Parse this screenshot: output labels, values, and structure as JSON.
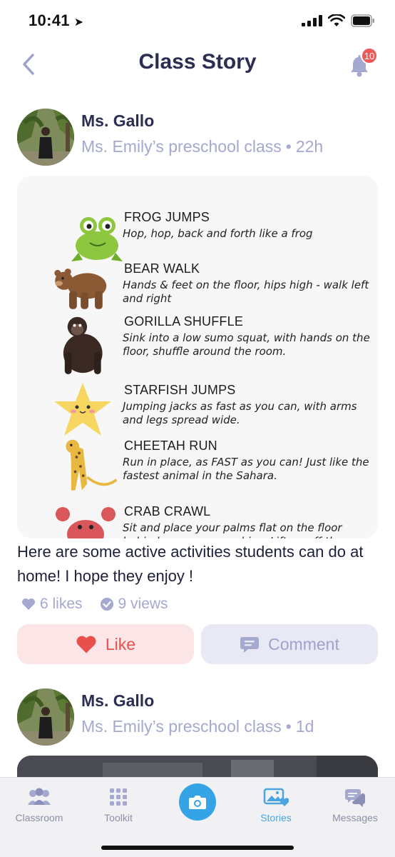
{
  "status_bar": {
    "time": "10:41",
    "location_icon": "location-arrow-icon"
  },
  "header": {
    "title": "Class Story",
    "notification_count": "10"
  },
  "posts": [
    {
      "author": "Ms. Gallo",
      "class_name": "Ms. Emily’s preschool class",
      "separator": "•",
      "time_ago": "22h",
      "image": {
        "activities": [
          {
            "name": "FROG JUMPS",
            "desc": "Hop, hop, back and forth like a frog",
            "icon": "frog"
          },
          {
            "name": "BEAR WALK",
            "desc": "Hands & feet on the floor, hips high - walk left and right",
            "icon": "bear"
          },
          {
            "name": "GORILLA SHUFFLE",
            "desc": "Sink into a low sumo squat, with hands on the floor, shuffle around the room.",
            "icon": "gorilla"
          },
          {
            "name": "STARFISH JUMPS",
            "desc": "Jumping jacks as fast as you can, with arms and legs spread wide.",
            "icon": "starfish"
          },
          {
            "name": "CHEETAH RUN",
            "desc": "Run in place, as FAST as you can! Just like the fastest animal in the Sahara.",
            "icon": "cheetah"
          },
          {
            "name": "CRAB CRAWL",
            "desc": "Sit and place your palms flat on the floor behind you near your hips. Lift up off the ground and crawl",
            "icon": "crab"
          }
        ]
      },
      "caption": "Here are some active activities students can do at home! I hope they enjoy !",
      "likes": "6 likes",
      "views": "9 views",
      "like_label": "Like",
      "comment_label": "Comment"
    },
    {
      "author": "Ms. Gallo",
      "class_name": "Ms. Emily’s preschool class",
      "separator": "•",
      "time_ago": "1d"
    }
  ],
  "tab_bar": {
    "tabs": [
      {
        "label": "Classroom",
        "icon": "classroom-icon"
      },
      {
        "label": "Toolkit",
        "icon": "toolkit-grid-icon"
      },
      {
        "label": "",
        "icon": "camera-icon"
      },
      {
        "label": "Stories",
        "icon": "stories-icon",
        "active": true
      },
      {
        "label": "Messages",
        "icon": "messages-icon"
      }
    ]
  },
  "colors": {
    "title": "#2b2d52",
    "meta": "#a5a8cf",
    "like": "#e8504e",
    "like_bg": "#fbe5e6",
    "comment_bg": "#e8e9f5",
    "badge": "#ee5a57",
    "active_tab": "#4aa4e0"
  }
}
